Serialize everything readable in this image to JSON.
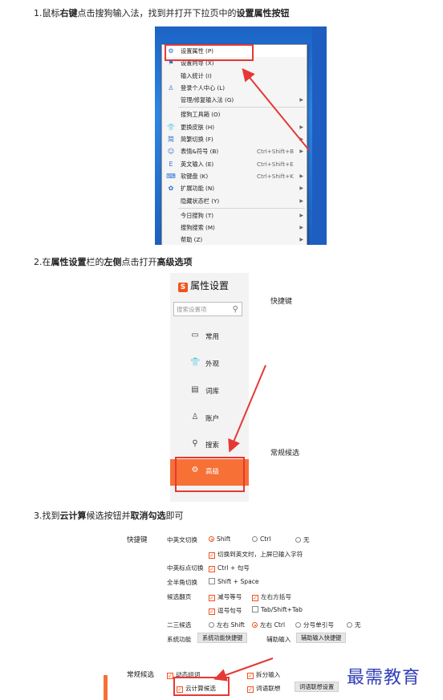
{
  "steps": {
    "s1_pre": "1.鼠标",
    "s1_b1": "右键",
    "s1_mid": "点击搜狗输入法，找到并打开下拉页中的",
    "s1_b2": "设置属性按钮",
    "s2_pre": "2.在",
    "s2_b1": "属性设置",
    "s2_mid1": "栏的",
    "s2_b2": "左侧",
    "s2_mid2": "点击打开",
    "s2_b3": "高级选项",
    "s3_pre": "3.找到",
    "s3_b1": "云计算",
    "s3_mid1": "候选按钮并",
    "s3_b2": "取消勾选",
    "s3_post": "即可"
  },
  "context_menu": [
    {
      "icon": "gear-icon",
      "glyph": "⚙",
      "label": "设置属性 (P)",
      "shortcut": "",
      "arrow": false,
      "sep_after": false,
      "highlight": true
    },
    {
      "icon": "flag-icon",
      "glyph": "⚑",
      "label": "设置向导 (X)",
      "shortcut": "",
      "arrow": false,
      "sep_after": false
    },
    {
      "icon": "",
      "glyph": "",
      "label": "输入统计 (I)",
      "shortcut": "",
      "arrow": false,
      "sep_after": false
    },
    {
      "icon": "user-icon",
      "glyph": "♙",
      "label": "登录个人中心 (L)",
      "shortcut": "",
      "arrow": false,
      "sep_after": false
    },
    {
      "icon": "",
      "glyph": "",
      "label": "管理/修复输入法 (G)",
      "shortcut": "",
      "arrow": true,
      "sep_after": true
    },
    {
      "icon": "",
      "glyph": "",
      "label": "搜狗工具箱 (O)",
      "shortcut": "",
      "arrow": false,
      "sep_after": false
    },
    {
      "icon": "shirt-icon",
      "glyph": "👕",
      "label": "更换皮肤 (H)",
      "shortcut": "",
      "arrow": true,
      "sep_after": false
    },
    {
      "icon": "jian-icon",
      "glyph": "简",
      "label": "简繁切换 (F)",
      "shortcut": "",
      "arrow": true,
      "sep_after": false
    },
    {
      "icon": "smile-icon",
      "glyph": "☺",
      "label": "表情&符号 (B)",
      "shortcut": "Ctrl+Shift+B",
      "arrow": true,
      "sep_after": false
    },
    {
      "icon": "e-icon",
      "glyph": "E",
      "label": "英文输入 (E)",
      "shortcut": "Ctrl+Shift+E",
      "arrow": false,
      "sep_after": false
    },
    {
      "icon": "keyboard-icon",
      "glyph": "⌨",
      "label": "软键盘 (K)",
      "shortcut": "Ctrl+Shift+K",
      "arrow": true,
      "sep_after": false
    },
    {
      "icon": "puzzle-icon",
      "glyph": "✿",
      "label": "扩展功能 (N)",
      "shortcut": "",
      "arrow": true,
      "sep_after": false
    },
    {
      "icon": "",
      "glyph": "",
      "label": "隐藏状态栏 (Y)",
      "shortcut": "",
      "arrow": true,
      "sep_after": true
    },
    {
      "icon": "",
      "glyph": "",
      "label": "今日搜狗 (T)",
      "shortcut": "",
      "arrow": true,
      "sep_after": false
    },
    {
      "icon": "",
      "glyph": "",
      "label": "搜狗搜索 (M)",
      "shortcut": "",
      "arrow": true,
      "sep_after": false
    },
    {
      "icon": "",
      "glyph": "",
      "label": "帮助 (Z)",
      "shortcut": "",
      "arrow": true,
      "sep_after": false
    }
  ],
  "settings_panel": {
    "logo": "S",
    "title": "属性设置",
    "search_placeholder": "搜索设置项",
    "nav": [
      {
        "icon": "monitor-icon",
        "glyph": "▭",
        "label": "常用",
        "active": false
      },
      {
        "icon": "shirt-icon",
        "glyph": "👕",
        "label": "外观",
        "active": false
      },
      {
        "icon": "book-icon",
        "glyph": "▤",
        "label": "词库",
        "active": false
      },
      {
        "icon": "user-icon",
        "glyph": "♙",
        "label": "账户",
        "active": false
      },
      {
        "icon": "search-icon",
        "glyph": "⚲",
        "label": "搜索",
        "active": false
      },
      {
        "icon": "gear-icon",
        "glyph": "⚙",
        "label": "高级",
        "active": true
      }
    ],
    "side_label_1": "快捷键",
    "side_label_2": "常规候选"
  },
  "advanced": {
    "sec_hotkey": "快捷键",
    "cn_en_switch": "中英文切换",
    "opt_shift": "Shift",
    "opt_ctrl": "Ctrl",
    "opt_none": "无",
    "commit_on_switch": "切换到英文时，上屏已输入字符",
    "cn_en_punct": "中英标点切换",
    "punct_opt": "Ctrl + 句号",
    "full_half": "全半角切换",
    "full_half_opt": "Shift + Space",
    "page_turn": "候选翻页",
    "pt_minus_equal": "减号等号",
    "pt_brackets": "左右方括号",
    "pt_comma_period": "逗号句号",
    "pt_tab": "Tab/Shift+Tab",
    "second_third": "二三候选",
    "st_shift": "左右 Shift",
    "st_ctrl": "左右 Ctrl",
    "st_quote": "分号单引号",
    "st_none": "无",
    "sys_func": "系统功能",
    "sys_func_btn": "系统功能快捷键",
    "aux_input": "辅助输入",
    "aux_input_btn": "辅助输入快捷键",
    "sec_candidate": "常规候选",
    "dynamic_phrase": "动态组词",
    "pinyin_input": "拆分输入",
    "cloud_candidate": "云计算候选",
    "word_assoc": "词语联想",
    "assoc_btn": "词语联想设置"
  },
  "watermark": "最需教育"
}
